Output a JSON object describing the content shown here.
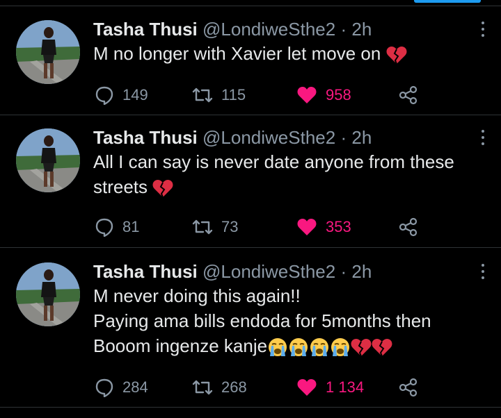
{
  "tweets": [
    {
      "name": "Tasha Thusi",
      "handle": "@LondiweSthe2",
      "separator": "·",
      "time": "2h",
      "lines": [
        "M no longer with Xavier let move on"
      ],
      "emoji_after": [
        "broken-heart"
      ],
      "replies": "149",
      "retweets": "115",
      "likes": "958",
      "liked": true
    },
    {
      "name": "Tasha Thusi",
      "handle": "@LondiweSthe2",
      "separator": "·",
      "time": "2h",
      "lines": [
        "All I can say is never date anyone from these",
        "streets"
      ],
      "emoji_after": [
        "broken-heart"
      ],
      "replies": "81",
      "retweets": "73",
      "likes": "353",
      "liked": true
    },
    {
      "name": "Tasha Thusi",
      "handle": "@LondiweSthe2",
      "separator": "·",
      "time": "2h",
      "lines": [
        "M never doing this again!!",
        "Paying ama bills endoda for 5months then",
        "Booom ingenze kanje"
      ],
      "emoji_after": [
        "loudly-crying-face",
        "loudly-crying-face",
        "loudly-crying-face",
        "loudly-crying-face",
        "broken-heart",
        "broken-heart"
      ],
      "replies": "284",
      "retweets": "268",
      "likes": "1 134",
      "liked": true
    }
  ],
  "colors": {
    "background": "#000000",
    "text": "#e7e9ea",
    "secondary": "#8b98a5",
    "like": "#f91880",
    "accent": "#1d9bf0",
    "divider": "#2f3336"
  }
}
